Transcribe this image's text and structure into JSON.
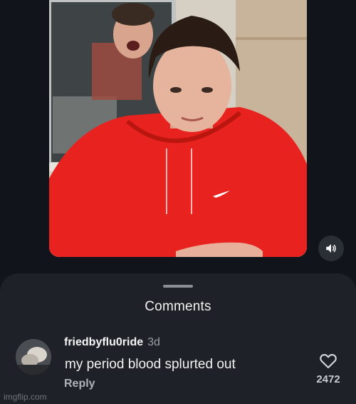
{
  "sheet": {
    "title": "Comments"
  },
  "comment": {
    "username": "friedbyflu0ride",
    "timestamp": "3d",
    "text": "my period blood splurted out",
    "reply_label": "Reply",
    "like_count": "2472"
  },
  "watermark": {
    "text": "imgflip.com"
  },
  "icons": {
    "volume": "speaker-volume-icon",
    "like": "heart-outline-icon"
  },
  "colors": {
    "background": "#12161c",
    "sheet": "#1e2228",
    "hoodie": "#e8231f"
  }
}
